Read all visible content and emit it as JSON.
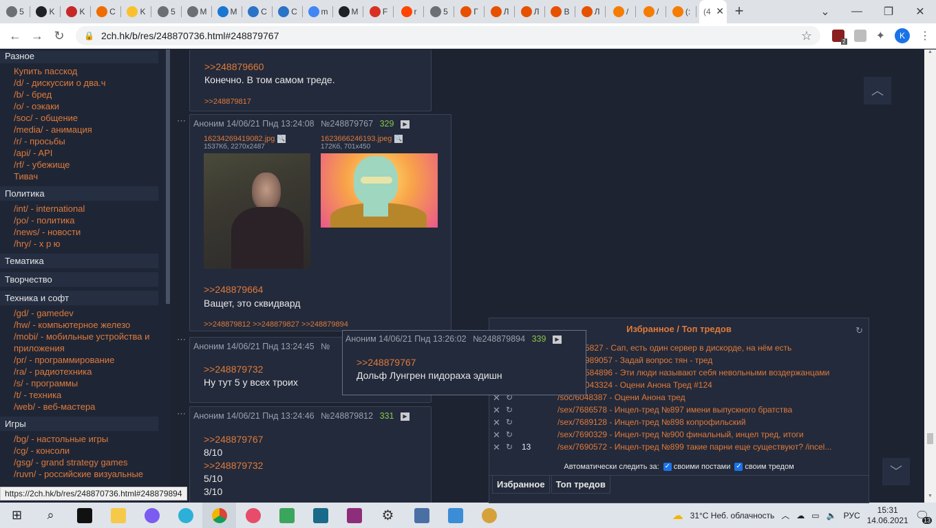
{
  "browser": {
    "tabs": [
      {
        "label": "5",
        "color": "#6c6f75"
      },
      {
        "label": "K",
        "color": "#202124"
      },
      {
        "label": "K",
        "color": "#c62828"
      },
      {
        "label": "C",
        "color": "#ef6c00"
      },
      {
        "label": "K",
        "color": "#fbc02d"
      },
      {
        "label": "5",
        "color": "#6c6f75"
      },
      {
        "label": "M",
        "color": "#6c6f75"
      },
      {
        "label": "M",
        "color": "#1976d2"
      },
      {
        "label": "C",
        "color": "#2a73c7"
      },
      {
        "label": "C",
        "color": "#2a73c7"
      },
      {
        "label": "m",
        "color": "#4285f4"
      },
      {
        "label": "M",
        "color": "#202124"
      },
      {
        "label": "F",
        "color": "#d93025"
      },
      {
        "label": "r",
        "color": "#ff4500"
      },
      {
        "label": "5",
        "color": "#6c6f75"
      },
      {
        "label": "Г",
        "color": "#e65100"
      },
      {
        "label": "Л",
        "color": "#e65100"
      },
      {
        "label": "Л",
        "color": "#e65100"
      },
      {
        "label": "В",
        "color": "#e65100"
      },
      {
        "label": "Л",
        "color": "#e65100"
      },
      {
        "label": "/",
        "color": "#f57c00"
      },
      {
        "label": "/",
        "color": "#f57c00"
      },
      {
        "label": "(:",
        "color": "#f57c00"
      }
    ],
    "active_tab_label": "(4",
    "url": "2ch.hk/b/res/248870736.html#248879767",
    "profile_initial": "K",
    "ext_badge": "2"
  },
  "sidebar": {
    "sections": [
      {
        "title": "Разное",
        "links": [
          "Купить пасскод",
          "/d/ - дискуссии о два.ч",
          "/b/ - бред",
          "/o/ - оэкаки",
          "/soc/ - общение",
          "/media/ - анимация",
          "/r/ - просьбы",
          "/api/ - API",
          "/rf/ - убежище",
          "Тивач"
        ]
      },
      {
        "title": "Политика",
        "links": [
          "/int/ - international",
          "/po/ - политика",
          "/news/ - новости",
          "/hry/ - х р ю"
        ]
      },
      {
        "title": "Тематика",
        "links": []
      },
      {
        "title": "Творчество",
        "links": []
      },
      {
        "title": "Техника и софт",
        "links": [
          "/gd/ - gamedev",
          "/hw/ - компьютерное железо",
          "/mobi/ - мобильные устройства и приложения",
          "/pr/ - программирование",
          "/ra/ - радиотехника",
          "/s/ - программы",
          "/t/ - техника",
          "/web/ - веб-мастера"
        ]
      },
      {
        "title": "Игры",
        "links": [
          "/bg/ - настольные игры",
          "/cg/ - консоли",
          "/gsg/ - grand strategy games",
          "/ruvn/ - российские визуальные"
        ]
      }
    ]
  },
  "posts": {
    "p0": {
      "reply": ">>248879660",
      "text": "Конечно. В том самом треде.",
      "backlinks": ">>248879817"
    },
    "p1": {
      "author": "Аноним",
      "date": "14/06/21 Пнд 13:24:08",
      "id": "№248879767",
      "num": "329",
      "file1": {
        "name": "16234269419082.jpg",
        "meta": "1537Кб, 2270x2487"
      },
      "file2": {
        "name": "1623666246193.jpeg",
        "meta": "172Кб, 701x450"
      },
      "reply": ">>248879664",
      "text": "Ващет, это сквидвард",
      "backlinks": ">>248879812 >>248879827 >>248879894"
    },
    "p2": {
      "author": "Аноним",
      "date": "14/06/21 Пнд 13:24:45",
      "id": "№",
      "reply": ">>248879732",
      "text": "Ну тут 5 у всех троих"
    },
    "p3": {
      "author": "Аноним",
      "date": "14/06/21 Пнд 13:24:46",
      "id": "№248879812",
      "num": "331",
      "reply1": ">>248879767",
      "text1": "8/10",
      "reply2": ">>248879732",
      "text2": "5/10",
      "text3": "3/10"
    }
  },
  "popup": {
    "author": "Аноним",
    "date": "14/06/21 Пнд 13:26:02",
    "id": "№248879894",
    "num": "339",
    "reply": ">>248879767",
    "text": "Дольф Лунгрен пидораха эдишн"
  },
  "favorites": {
    "title": "Избранное / Топ тредов",
    "rows": [
      {
        "count": "",
        "text": "5827 - Сап, есть один сервер в дискорде, на нём есть"
      },
      {
        "count": "",
        "text": "989057 - Задай вопрос тян - тред"
      },
      {
        "count": "",
        "text": "584896 - Эти люди называют себя невольными воздержанцами"
      },
      {
        "count": "",
        "text": "043324 - Оцени Анона Тред #124"
      },
      {
        "count": "",
        "text": "/soc/6048387 - Оцени Анона тред"
      },
      {
        "count": "",
        "text": "/sex/7686578 - Инцел-тред №897 имени выпускного братства"
      },
      {
        "count": "",
        "text": "/sex/7689128 - Инцел-тред №898 копрофильский"
      },
      {
        "count": "",
        "text": "/sex/7690329 - Инцел-тред №900 финальный, инцел тред, итоги"
      },
      {
        "count": "13",
        "text": "/sex/7690572 - Инцел-тред №899 такие парни еще существуют? /incel..."
      }
    ],
    "auto_label": "Автоматически следить за:",
    "opt1": "своими постами",
    "opt2": "своим тредом",
    "tab1": "Избранное",
    "tab2": "Топ тредов"
  },
  "status_url": "https://2ch.hk/b/res/248870736.html#248879894",
  "taskbar": {
    "weather": "31°C  Неб. облачность",
    "lang": "РУС",
    "time": "15:31",
    "date": "14.06.2021",
    "notif": "13"
  }
}
